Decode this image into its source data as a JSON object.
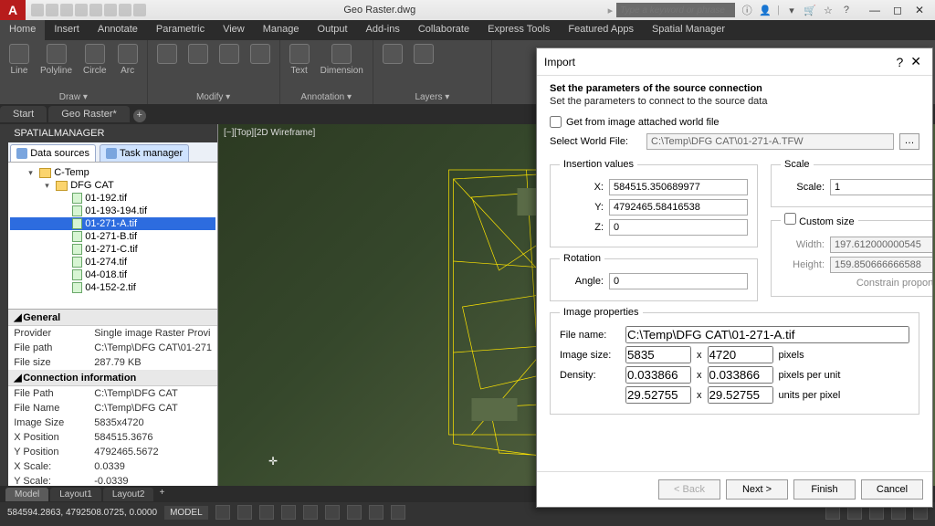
{
  "title": "Geo Raster.dwg",
  "search_placeholder": "Type a keyword or phrase",
  "ribbon_tabs": [
    "Home",
    "Insert",
    "Annotate",
    "Parametric",
    "View",
    "Manage",
    "Output",
    "Add-ins",
    "Collaborate",
    "Express Tools",
    "Featured Apps",
    "Spatial Manager"
  ],
  "ribbon_groups": {
    "draw": "Draw ▾",
    "modify": "Modify ▾",
    "annotation": "Annotation ▾",
    "layers": "Layers ▾",
    "draw_items": [
      "Line",
      "Polyline",
      "Circle",
      "Arc"
    ],
    "anno_items": [
      "Text",
      "Dimension"
    ]
  },
  "doc_tabs": [
    "Start",
    "Geo Raster*"
  ],
  "palette": {
    "title": "SPATIALMANAGER",
    "tabs": [
      "Data sources",
      "Task manager"
    ],
    "tree_root": "C-Temp",
    "tree_folder": "DFG CAT",
    "files": [
      "01-192.tif",
      "01-193-194.tif",
      "01-271-A.tif",
      "01-271-B.tif",
      "01-271-C.tif",
      "01-274.tif",
      "04-018.tif",
      "04-152-2.tif"
    ],
    "sel_index": 2,
    "general_hdr": "General",
    "general": [
      [
        "Provider",
        "Single image Raster Provi"
      ],
      [
        "File path",
        "C:\\Temp\\DFG CAT\\01-271"
      ],
      [
        "File size",
        "287.79 KB"
      ]
    ],
    "conn_hdr": "Connection information",
    "conn": [
      [
        "File Path",
        "C:\\Temp\\DFG CAT"
      ],
      [
        "File Name",
        "C:\\Temp\\DFG CAT"
      ],
      [
        "Image Size",
        "5835x4720"
      ],
      [
        "X Position",
        "584515.3676"
      ],
      [
        "Y Position",
        "4792465.5672"
      ],
      [
        "X Scale:",
        "0.0339"
      ],
      [
        "Y Scale:",
        "-0.0339"
      ]
    ]
  },
  "viewport_label": "[−][Top][2D Wireframe]",
  "layout_tabs": [
    "Model",
    "Layout1",
    "Layout2"
  ],
  "status_coords": "584594.2863, 4792508.0725, 0.0000",
  "status_model": "MODEL",
  "dialog": {
    "title": "Import",
    "heading": "Set the parameters of the source connection",
    "sub": "Set the parameters to connect to the source data",
    "chk_world": "Get from image attached world file",
    "world_label": "Select World File:",
    "world_path": "C:\\Temp\\DFG CAT\\01-271-A.TFW",
    "insertion_legend": "Insertion values",
    "x_label": "X:",
    "x": "584515.350689977",
    "y_label": "Y:",
    "y": "4792465.58416538",
    "z_label": "Z:",
    "z": "0",
    "rotation_legend": "Rotation",
    "angle_label": "Angle:",
    "angle": "0",
    "scale_legend": "Scale",
    "scale_label": "Scale:",
    "scale": "1",
    "custom_legend": "Custom size",
    "width_label": "Width:",
    "width": "197.612000000545",
    "height_label": "Height:",
    "height": "159.850666666588",
    "constrain": "Constrain proportions",
    "imgprops_legend": "Image properties",
    "fn_label": "File name:",
    "fn": "C:\\Temp\\DFG CAT\\01-271-A.tif",
    "sz_label": "Image size:",
    "sz_w": "5835",
    "sz_h": "4720",
    "sz_unit": "pixels",
    "den_label": "Density:",
    "den_x": "0.033866",
    "den_y": "0.033866",
    "den_unit": "pixels per unit",
    "up_x": "29.52755",
    "up_y": "29.52755",
    "up_unit": "units per pixel",
    "btn_back": "< Back",
    "btn_next": "Next >",
    "btn_finish": "Finish",
    "btn_cancel": "Cancel"
  }
}
